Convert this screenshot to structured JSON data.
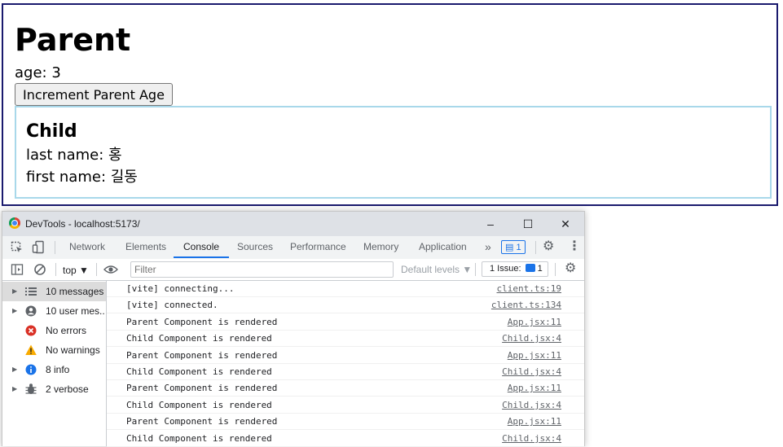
{
  "app": {
    "parent_title": "Parent",
    "age_text": "age: 3",
    "increment_button": "Increment Parent Age",
    "child_title": "Child",
    "last_name_text": "last name: 홍",
    "first_name_text": "first name: 길동"
  },
  "devtools": {
    "window_title": "DevTools - localhost:5173/",
    "window_controls": {
      "minimize": "–",
      "maximize": "☐",
      "close": "✕"
    },
    "tabs": [
      "Network",
      "Elements",
      "Console",
      "Sources",
      "Performance",
      "Memory",
      "Application"
    ],
    "active_tab": "Console",
    "more_tabs": "»",
    "messages_badge": "1",
    "toolbar": {
      "context": "top ▼",
      "filter_placeholder": "Filter",
      "levels": "Default levels ▼",
      "issues": "1 Issue:",
      "issues_count": "1"
    },
    "sidebar": [
      {
        "label": "10 messages",
        "icon": "list-icon",
        "arrow": "▶"
      },
      {
        "label": "10 user mes...",
        "icon": "user-icon",
        "arrow": "▶"
      },
      {
        "label": "No errors",
        "icon": "error-icon",
        "arrow": ""
      },
      {
        "label": "No warnings",
        "icon": "warning-icon",
        "arrow": ""
      },
      {
        "label": "8 info",
        "icon": "info-icon",
        "arrow": "▶"
      },
      {
        "label": "2 verbose",
        "icon": "bug-icon",
        "arrow": "▶"
      }
    ],
    "console": [
      {
        "text": "[vite] connecting...",
        "source": "client.ts:19"
      },
      {
        "text": "[vite] connected.",
        "source": "client.ts:134"
      },
      {
        "text": "Parent Component is rendered",
        "source": "App.jsx:11"
      },
      {
        "text": "Child Component is rendered",
        "source": "Child.jsx:4"
      },
      {
        "text": "Parent Component is rendered",
        "source": "App.jsx:11"
      },
      {
        "text": "Child Component is rendered",
        "source": "Child.jsx:4"
      },
      {
        "text": "Parent Component is rendered",
        "source": "App.jsx:11"
      },
      {
        "text": "Child Component is rendered",
        "source": "Child.jsx:4"
      },
      {
        "text": "Parent Component is rendered",
        "source": "App.jsx:11"
      },
      {
        "text": "Child Component is rendered",
        "source": "Child.jsx:4"
      }
    ],
    "colors": {
      "accent": "#1a73e8",
      "error": "#d93025",
      "warning": "#f9ab00",
      "info": "#1a73e8"
    }
  }
}
